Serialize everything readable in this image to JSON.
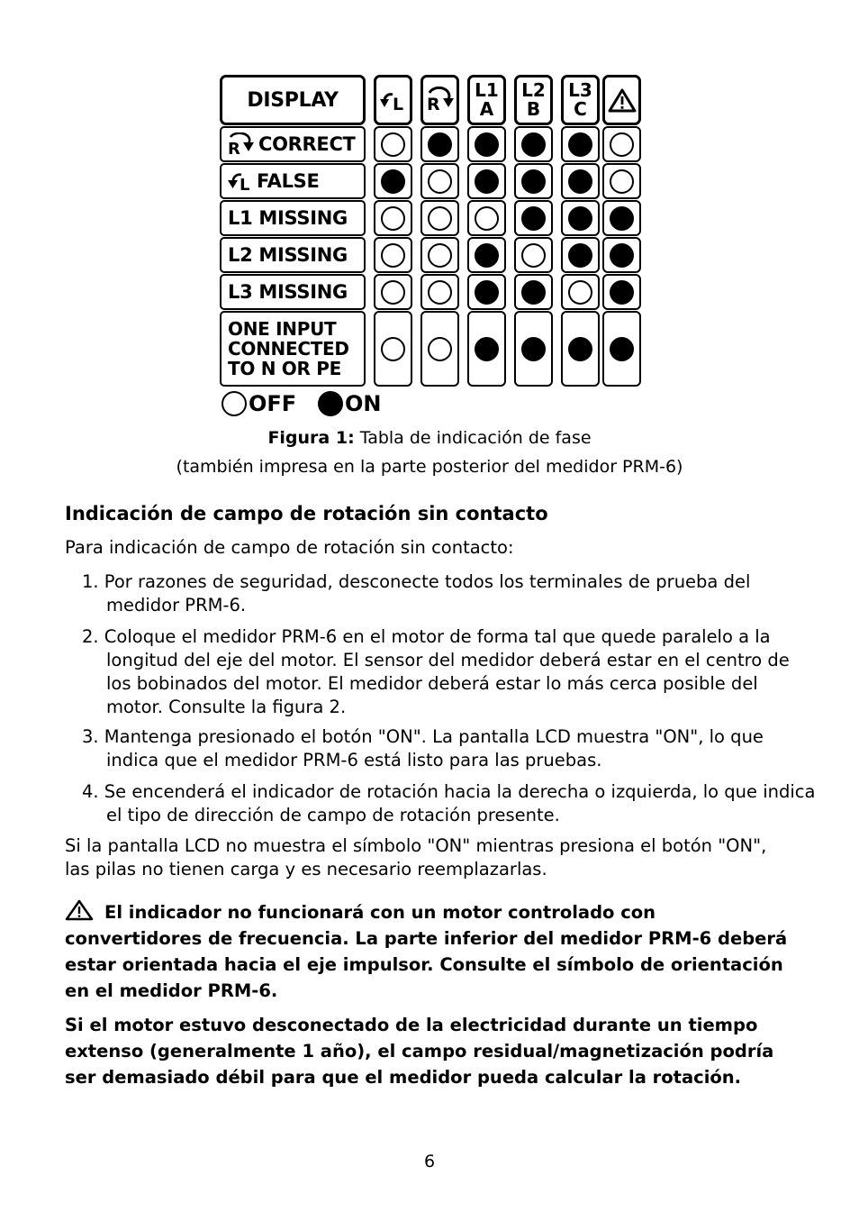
{
  "figure": {
    "header": {
      "display_label": "DISPLAY",
      "columns": [
        {
          "id": "left-rotation",
          "icon": "rotate-left-L-icon",
          "text": "L"
        },
        {
          "id": "right-rotation",
          "icon": "rotate-right-R-icon",
          "text": "R"
        },
        {
          "id": "l1",
          "line1": "L1",
          "line2": "A"
        },
        {
          "id": "l2",
          "line1": "L2",
          "line2": "B"
        },
        {
          "id": "l3",
          "line1": "L3",
          "line2": "C"
        },
        {
          "id": "warning",
          "icon": "warning-triangle-icon"
        }
      ]
    },
    "rows": [
      {
        "label": "CORRECT",
        "icon": "rotate-right-R-icon",
        "states": [
          0,
          1,
          1,
          1,
          1,
          0
        ]
      },
      {
        "label": "FALSE",
        "icon": "rotate-left-L-icon",
        "states": [
          1,
          0,
          1,
          1,
          1,
          0
        ]
      },
      {
        "label": "L1 MISSING",
        "states": [
          0,
          0,
          0,
          1,
          1,
          1
        ]
      },
      {
        "label": "L2 MISSING",
        "states": [
          0,
          0,
          1,
          0,
          1,
          1
        ]
      },
      {
        "label": "L3 MISSING",
        "states": [
          0,
          0,
          1,
          1,
          0,
          1
        ]
      },
      {
        "label_lines": [
          "ONE INPUT",
          "CONNECTED",
          "TO N OR PE"
        ],
        "states": [
          0,
          0,
          1,
          1,
          1,
          1
        ]
      }
    ],
    "legend": {
      "off": "OFF",
      "on": "ON"
    },
    "caption_bold": "Figura 1:",
    "caption_text": " Tabla de indicación de fase",
    "caption_line2": "(también impresa en la parte posterior del medidor PRM-6)"
  },
  "section": {
    "heading": "Indicación de campo de rotación sin contacto",
    "intro": "Para indicación de campo de rotación sin contacto:",
    "steps": [
      "1. Por razones de seguridad, desconecte todos los terminales de prueba del medidor PRM-6.",
      "2. Coloque el medidor PRM-6 en el motor de forma tal que quede paralelo a la longitud del eje del motor. El sensor del medidor deberá estar en el centro de los bobinados del motor. El medidor deberá estar lo más cerca posible del motor. Consulte la figura 2.",
      "3. Mantenga presionado el botón \"ON\". La pantalla LCD muestra \"ON\", lo que indica que el medidor PRM-6 está listo para las pruebas.",
      "4. Se encenderá el indicador de rotación hacia la derecha o izquierda, lo que indica el tipo de dirección de campo de rotación presente."
    ],
    "battery_note": "Si la pantalla LCD no muestra el símbolo \"ON\" mientras presiona el botón \"ON\", las pilas no tienen carga y es necesario reemplazarlas.",
    "warning_text": "El indicador no funcionará con un motor controlado con convertidores de frecuencia. La parte inferior del medidor PRM-6 deberá estar orientada hacia el eje impulsor. Consulte el símbolo de orientación en el medidor PRM-6.",
    "residual_note": "Si el motor estuvo desconectado de la electricidad durante un tiempo extenso (generalmente 1 año), el campo residual/magnetización podría ser demasiado débil para que el medidor pueda calcular la rotación."
  },
  "page_number": "6",
  "colors": {
    "ink": "#000000",
    "paper": "#ffffff"
  }
}
